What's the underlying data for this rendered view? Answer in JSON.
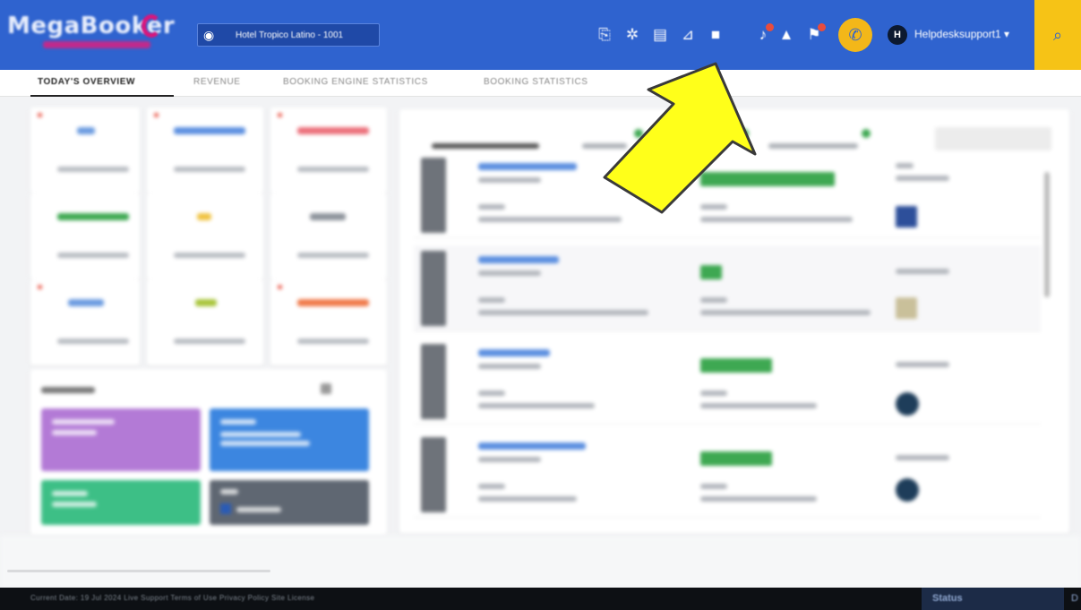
{
  "header": {
    "logo_text": "MegaBooker",
    "hotel_selector": "Hotel Tropico Latino - 1001",
    "user_initial": "H",
    "user_name": "Helpdesksupport1 ▾",
    "icons": [
      "globe-icon",
      "translate-icon",
      "users-icon",
      "edit-icon",
      "chart-icon",
      "window-icon",
      "pin-icon",
      "bell-icon",
      "flag-icon",
      "megaphone-icon",
      "search-icon"
    ]
  },
  "tabs": [
    {
      "label": "TODAY'S OVERVIEW",
      "active": true
    },
    {
      "label": "REVENUE",
      "active": false
    },
    {
      "label": "BOOKING ENGINE STATISTICS",
      "active": false
    },
    {
      "label": "BOOKING STATISTICS",
      "active": false
    }
  ],
  "footer": {
    "text": "Current Date: 19 Jul 2024   Live Support   Terms of Use   Privacy Policy   Site License",
    "status_label": "Status",
    "trailing": "D"
  },
  "overlay": {
    "arrow_color": "#ffff1a"
  }
}
